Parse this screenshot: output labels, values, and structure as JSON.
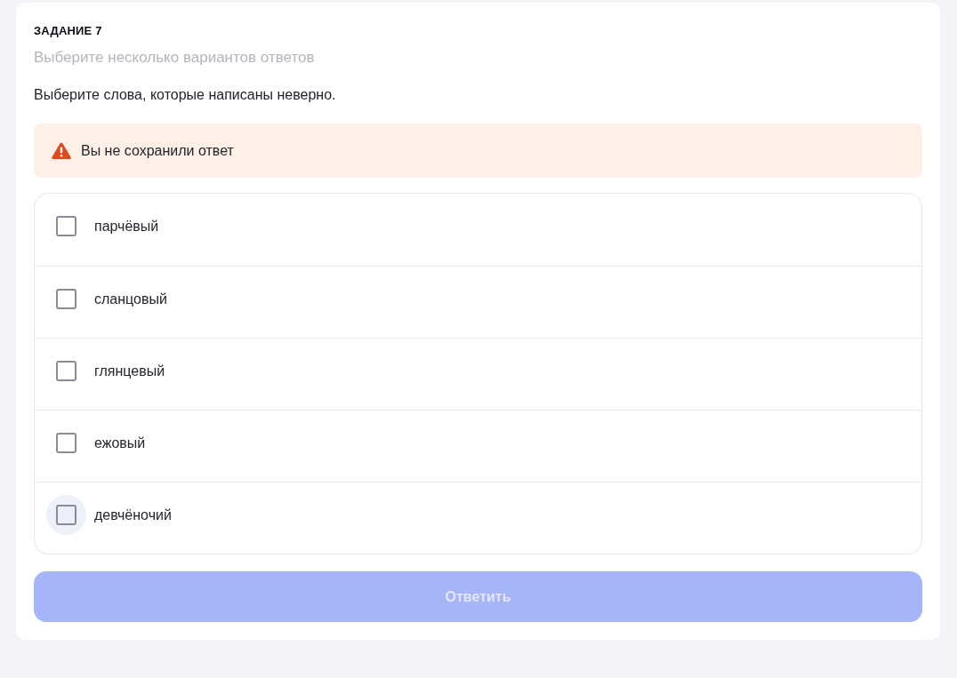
{
  "task": {
    "label": "ЗАДАНИЕ 7",
    "hint": "Выберите несколько вариантов ответов",
    "question": "Выберите слова, которые написаны неверно."
  },
  "alert": {
    "kind": "warning",
    "text": "Вы не сохранили ответ"
  },
  "options": [
    {
      "label": "парчёвый",
      "checked": false,
      "hovered": false
    },
    {
      "label": "сланцовый",
      "checked": false,
      "hovered": false
    },
    {
      "label": "глянцевый",
      "checked": false,
      "hovered": false
    },
    {
      "label": "ежовый",
      "checked": false,
      "hovered": false
    },
    {
      "label": "девчёночий",
      "checked": false,
      "hovered": true
    }
  ],
  "submit_button": {
    "label": "Ответить",
    "disabled": true
  }
}
